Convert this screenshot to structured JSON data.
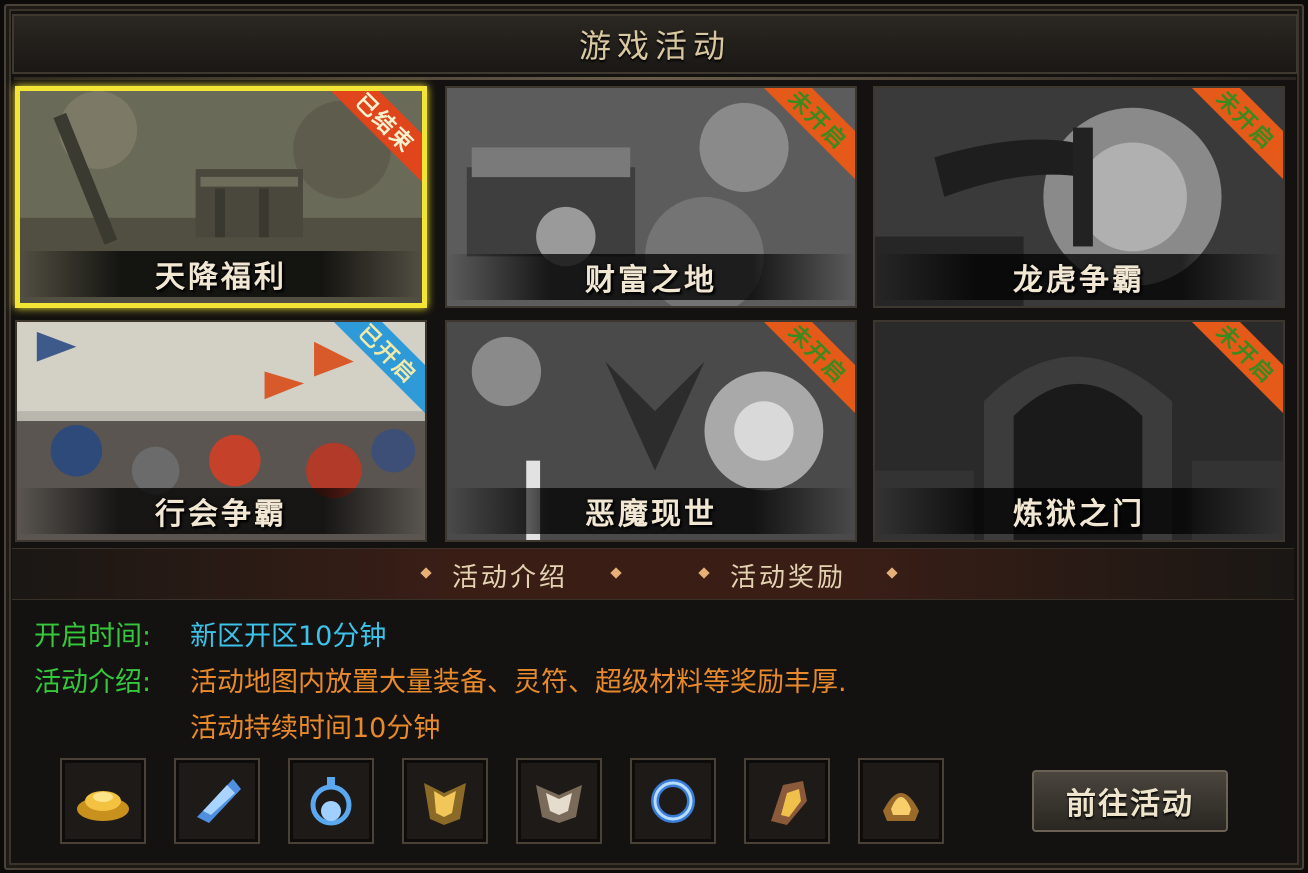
{
  "title": "游戏活动",
  "cards": [
    {
      "label": "天降福利",
      "status": "已结束",
      "status_color": "#e0451b"
    },
    {
      "label": "财富之地",
      "status": "未开启",
      "status_color": "#e55a18"
    },
    {
      "label": "龙虎争霸",
      "status": "未开启",
      "status_color": "#e55a18"
    },
    {
      "label": "行会争霸",
      "status": "已开启",
      "status_color": "#2f9ad8"
    },
    {
      "label": "恶魔现世",
      "status": "未开启",
      "status_color": "#e55a18"
    },
    {
      "label": "炼狱之门",
      "status": "未开启",
      "status_color": "#e55a18"
    }
  ],
  "tabs": [
    "活动介绍",
    "活动奖励"
  ],
  "info": {
    "open_time_label": "开启时间:",
    "open_time_value": "新区开区10分钟",
    "desc_label": "活动介绍:",
    "desc_line1": "活动地图内放置大量装备、灵符、超级材料等奖励丰厚.",
    "desc_line2": "活动持续时间10分钟"
  },
  "rewards": [
    "gold-ingot-icon",
    "blue-crystal-icon",
    "blue-ring-pendant-icon",
    "golden-armor-icon",
    "silver-armor-icon",
    "blue-bracelet-icon",
    "gold-gauntlet-icon",
    "golden-helmet-icon"
  ],
  "go_button": "前往活动",
  "colors": {
    "selected_border": "#f3e536",
    "label_green": "#35c83c",
    "value_blue": "#3cc3ea",
    "value_orange": "#e88a2c"
  }
}
